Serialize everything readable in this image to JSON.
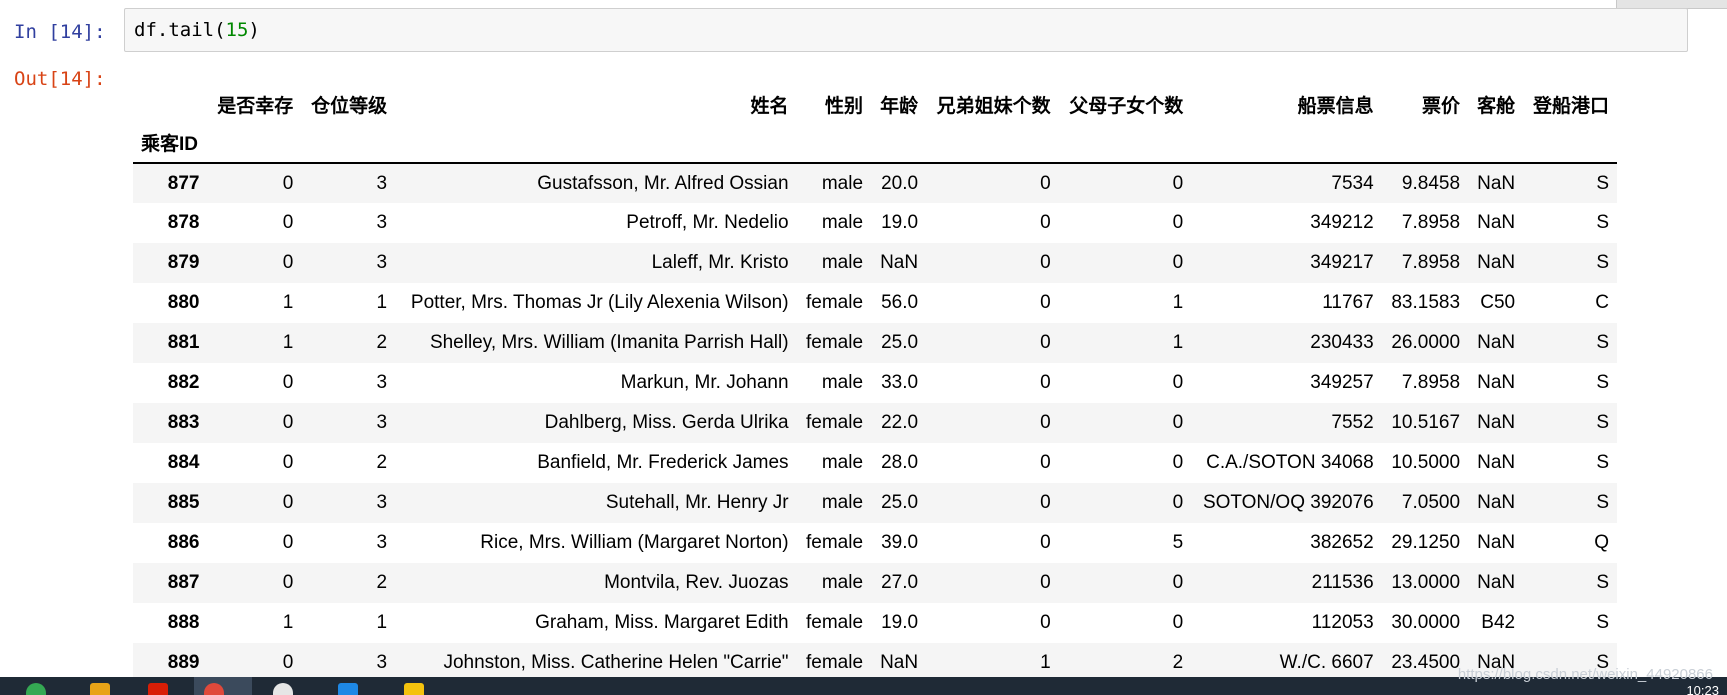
{
  "cell": {
    "in_prompt": "In  [14]:",
    "out_prompt": "Out[14]:",
    "code_prefix": "df.tail(",
    "code_arg": "15",
    "code_suffix": ")"
  },
  "table": {
    "index_name": "乘客ID",
    "columns": [
      "是否幸存",
      "仓位等级",
      "姓名",
      "性别",
      "年龄",
      "兄弟姐妹个数",
      "父母子女个数",
      "船票信息",
      "票价",
      "客舱",
      "登船港口"
    ],
    "rows": [
      [
        "877",
        "0",
        "3",
        "Gustafsson, Mr. Alfred Ossian",
        "male",
        "20.0",
        "0",
        "0",
        "7534",
        "9.8458",
        "NaN",
        "S"
      ],
      [
        "878",
        "0",
        "3",
        "Petroff, Mr. Nedelio",
        "male",
        "19.0",
        "0",
        "0",
        "349212",
        "7.8958",
        "NaN",
        "S"
      ],
      [
        "879",
        "0",
        "3",
        "Laleff, Mr. Kristo",
        "male",
        "NaN",
        "0",
        "0",
        "349217",
        "7.8958",
        "NaN",
        "S"
      ],
      [
        "880",
        "1",
        "1",
        "Potter, Mrs. Thomas Jr (Lily Alexenia Wilson)",
        "female",
        "56.0",
        "0",
        "1",
        "11767",
        "83.1583",
        "C50",
        "C"
      ],
      [
        "881",
        "1",
        "2",
        "Shelley, Mrs. William (Imanita Parrish Hall)",
        "female",
        "25.0",
        "0",
        "1",
        "230433",
        "26.0000",
        "NaN",
        "S"
      ],
      [
        "882",
        "0",
        "3",
        "Markun, Mr. Johann",
        "male",
        "33.0",
        "0",
        "0",
        "349257",
        "7.8958",
        "NaN",
        "S"
      ],
      [
        "883",
        "0",
        "3",
        "Dahlberg, Miss. Gerda Ulrika",
        "female",
        "22.0",
        "0",
        "0",
        "7552",
        "10.5167",
        "NaN",
        "S"
      ],
      [
        "884",
        "0",
        "2",
        "Banfield, Mr. Frederick James",
        "male",
        "28.0",
        "0",
        "0",
        "C.A./SOTON 34068",
        "10.5000",
        "NaN",
        "S"
      ],
      [
        "885",
        "0",
        "3",
        "Sutehall, Mr. Henry Jr",
        "male",
        "25.0",
        "0",
        "0",
        "SOTON/OQ 392076",
        "7.0500",
        "NaN",
        "S"
      ],
      [
        "886",
        "0",
        "3",
        "Rice, Mrs. William (Margaret Norton)",
        "female",
        "39.0",
        "0",
        "5",
        "382652",
        "29.1250",
        "NaN",
        "Q"
      ],
      [
        "887",
        "0",
        "2",
        "Montvila, Rev. Juozas",
        "male",
        "27.0",
        "0",
        "0",
        "211536",
        "13.0000",
        "NaN",
        "S"
      ],
      [
        "888",
        "1",
        "1",
        "Graham, Miss. Margaret Edith",
        "female",
        "19.0",
        "0",
        "0",
        "112053",
        "30.0000",
        "B42",
        "S"
      ],
      [
        "889",
        "0",
        "3",
        "Johnston, Miss. Catherine Helen \"Carrie\"",
        "female",
        "NaN",
        "1",
        "2",
        "W./C. 6607",
        "23.4500",
        "NaN",
        "S"
      ]
    ]
  },
  "taskbar": {
    "watermark": "https://blog.csdn.net/weixin_44920866",
    "clock": "10:23",
    "icons": [
      "chrome-icon",
      "folder-icon",
      "app-red-icon",
      "app-active-icon",
      "clock-app-icon",
      "app-blue-icon",
      "app-yellow-icon"
    ],
    "colors": {
      "chrome-icon": "#34a853",
      "folder-icon": "#e8a317",
      "app-red-icon": "#d81e06",
      "app-active-icon": "#e0493b",
      "clock-app-icon": "#e6e6e6",
      "app-blue-icon": "#1e88e5",
      "app-yellow-icon": "#f4c20d"
    }
  }
}
